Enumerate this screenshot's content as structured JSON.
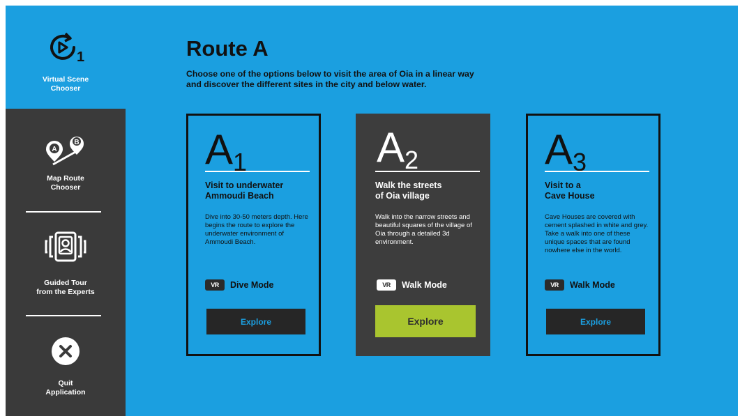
{
  "sidebar": {
    "virtual_scene": {
      "label": "Virtual Scene\nChooser",
      "icon": "replay-play-icon",
      "badge": "1"
    },
    "map_route": {
      "label": "Map Route\nChooser",
      "icon": "map-pins-icon",
      "pin_a": "A",
      "pin_b": "B"
    },
    "guided_tour": {
      "label": "Guided Tour\nfrom the Experts",
      "icon": "expert-guide-icon"
    },
    "quit": {
      "label": "Quit\nApplication",
      "icon": "close-icon"
    }
  },
  "header": {
    "title": "Route A",
    "description": "Choose one of the options below to visit the area of Oia in a linear way\nand discover the different sites in the city and below water."
  },
  "cards": [
    {
      "letter": "A",
      "number": "1",
      "title": "Visit to underwater\nAmmoudi Beach",
      "description": "Dive into 30-50 meters depth. Here begins the route to explore the underwater environment of Ammoudi Beach.",
      "vr_badge": "VR",
      "mode": "Dive Mode",
      "button": "Explore",
      "selected": false
    },
    {
      "letter": "A",
      "number": "2",
      "title": "Walk the streets\nof Oia village",
      "description": "Walk into the narrow streets and beautiful squares of the village of Oia through a detailed 3d environment.",
      "vr_badge": "VR",
      "mode": "Walk Mode",
      "button": "Explore",
      "selected": true
    },
    {
      "letter": "A",
      "number": "3",
      "title": "Visit to a\nCave House",
      "description": "Cave Houses are covered with cement splashed in white and grey. Take a walk into one of these unique spaces that are found nowhere else in the world.",
      "vr_badge": "VR",
      "mode": "Walk Mode",
      "button": "Explore",
      "selected": false
    }
  ],
  "colors": {
    "background": "#1b9fe0",
    "sidebar_dark": "#3a3a3a",
    "card_selected": "#3d3d3d",
    "explore_active": "#a9c52f",
    "explore_default": "#262626"
  }
}
